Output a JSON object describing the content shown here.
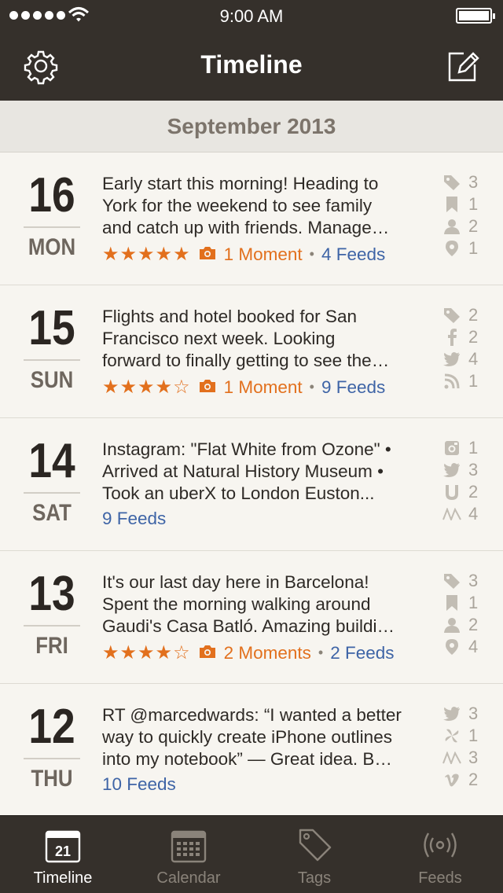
{
  "status_bar": {
    "time": "9:00 AM"
  },
  "nav": {
    "title": "Timeline",
    "left_icon": "gear-icon",
    "right_icon": "compose-icon"
  },
  "section": {
    "title": "September 2013"
  },
  "entries": [
    {
      "day": "16",
      "weekday": "MON",
      "lines": [
        "Early start this morning! Heading to",
        "York for the weekend to see family",
        "and catch up with friends. Manage…"
      ],
      "stars": "★★★★★",
      "moments": "1 Moment",
      "feeds": "4 Feeds",
      "icons": [
        {
          "icon": "tag-icon",
          "count": "3"
        },
        {
          "icon": "bookmark-icon",
          "count": "1"
        },
        {
          "icon": "person-icon",
          "count": "2"
        },
        {
          "icon": "location-pin-icon",
          "count": "1"
        }
      ]
    },
    {
      "day": "15",
      "weekday": "SUN",
      "lines": [
        "Flights and hotel booked for San",
        "Francisco next week. Looking",
        "forward to finally getting to see the…"
      ],
      "stars": "★★★★☆",
      "moments": "1 Moment",
      "feeds": "9 Feeds",
      "icons": [
        {
          "icon": "tag-icon",
          "count": "2"
        },
        {
          "icon": "facebook-icon",
          "count": "2"
        },
        {
          "icon": "twitter-icon",
          "count": "4"
        },
        {
          "icon": "rss-icon",
          "count": "1"
        }
      ]
    },
    {
      "day": "14",
      "weekday": "SAT",
      "lines": [
        "Instagram: \"Flat White from Ozone\"  •",
        "Arrived at Natural History Museum  •",
        "Took an uberX to London Euston..."
      ],
      "stars": "",
      "moments": "",
      "feeds": "9 Feeds",
      "icons": [
        {
          "icon": "instagram-icon",
          "count": "1"
        },
        {
          "icon": "twitter-icon",
          "count": "3"
        },
        {
          "icon": "uber-icon",
          "count": "2"
        },
        {
          "icon": "moves-icon",
          "count": "4"
        }
      ]
    },
    {
      "day": "13",
      "weekday": "FRI",
      "lines": [
        "It's our last day here in Barcelona!",
        "Spent the morning walking around",
        "Gaudi's Casa Batló. Amazing buildi…"
      ],
      "stars": "★★★★☆",
      "moments": "2 Moments",
      "feeds": "2 Feeds",
      "icons": [
        {
          "icon": "tag-icon",
          "count": "3"
        },
        {
          "icon": "bookmark-icon",
          "count": "1"
        },
        {
          "icon": "person-icon",
          "count": "2"
        },
        {
          "icon": "location-pin-icon",
          "count": "4"
        }
      ]
    },
    {
      "day": "12",
      "weekday": "THU",
      "lines": [
        "RT @marcedwards: “I wanted a better",
        "way to quickly create iPhone outlines",
        "into my notebook” — Great idea. B…"
      ],
      "stars": "",
      "moments": "",
      "feeds": "10 Feeds",
      "icons": [
        {
          "icon": "twitter-icon",
          "count": "3"
        },
        {
          "icon": "pinwheel-icon",
          "count": "1"
        },
        {
          "icon": "moves-icon",
          "count": "3"
        },
        {
          "icon": "vimeo-icon",
          "count": "2"
        }
      ]
    }
  ],
  "tabs": [
    {
      "label": "Timeline",
      "icon": "calendar-day-icon",
      "badge": "21",
      "active": true
    },
    {
      "label": "Calendar",
      "icon": "calendar-grid-icon",
      "active": false
    },
    {
      "label": "Tags",
      "icon": "tag-icon",
      "active": false
    },
    {
      "label": "Feeds",
      "icon": "broadcast-icon",
      "active": false
    }
  ],
  "colors": {
    "bar": "#35302b",
    "accent_orange": "#e2701d",
    "feeds_blue": "#3e64a6"
  }
}
